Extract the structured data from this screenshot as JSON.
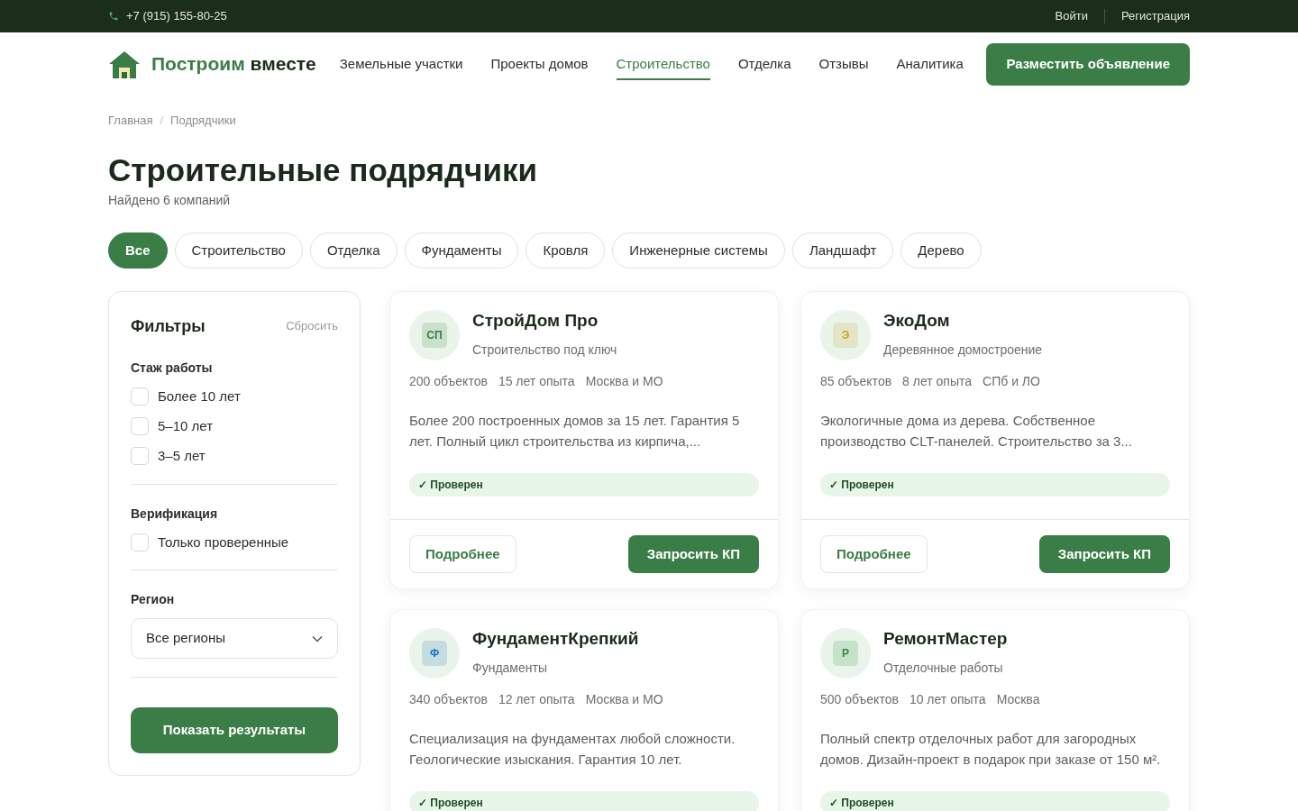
{
  "top_bar": {
    "phone": "+7 (915) 155-80-25",
    "links": [
      "Войти",
      "Регистрация"
    ]
  },
  "header": {
    "logo": {
      "accent": "Построим",
      "rest": "вместе"
    },
    "nav": [
      {
        "label": "Земельные участки",
        "selected": false
      },
      {
        "label": "Проекты домов",
        "selected": false
      },
      {
        "label": "Строительство",
        "selected": true
      },
      {
        "label": "Отделка",
        "selected": false
      },
      {
        "label": "Отзывы",
        "selected": false
      },
      {
        "label": "Аналитика",
        "selected": false
      }
    ],
    "cta": "Разместить объявление"
  },
  "breadcrumbs": {
    "items": [
      "Главная",
      "Подрядчики"
    ],
    "separator": "/"
  },
  "page": {
    "title": "Строительные подрядчики",
    "subtitle": "Найдено 6 компаний"
  },
  "categories": [
    {
      "label": "Все",
      "selected": true
    },
    {
      "label": "Строительство",
      "selected": false
    },
    {
      "label": "Отделка",
      "selected": false
    },
    {
      "label": "Фундаменты",
      "selected": false
    },
    {
      "label": "Кровля",
      "selected": false
    },
    {
      "label": "Инженерные системы",
      "selected": false
    },
    {
      "label": "Ландшафт",
      "selected": false
    },
    {
      "label": "Дерево",
      "selected": false
    }
  ],
  "filters": {
    "title": "Фильтры",
    "reset": "Сбросить",
    "groups": [
      {
        "kind": "checkboxes",
        "title": "Стаж работы",
        "options": [
          {
            "label": "Более 10 лет",
            "checked": false
          },
          {
            "label": "5–10 лет",
            "checked": false
          },
          {
            "label": "3–5 лет",
            "checked": false
          }
        ]
      },
      {
        "kind": "checkboxes",
        "title": "Верификация",
        "options": [
          {
            "label": "Только проверенные",
            "checked": false
          }
        ]
      },
      {
        "kind": "select",
        "title": "Регион",
        "value": "Все регионы"
      }
    ],
    "submit": "Показать результаты"
  },
  "companies": [
    {
      "initials": "СП",
      "color": "#3b7d46",
      "name": "СтройДом Про",
      "specialty": "Строительство под ключ",
      "stats": [
        "200 объектов",
        "15 лет опыта",
        "Москва и МО"
      ],
      "description": "Более 200 построенных домов за 15 лет. Гарантия 5 лет. Полный цикл строительства из кирпича,...",
      "badge": "✓ Проверен",
      "actions": {
        "details": "Подробнее",
        "request": "Запросить КП"
      }
    },
    {
      "initials": "Э",
      "color": "#c9a227",
      "name": "ЭкоДом",
      "specialty": "Деревянное домостроение",
      "stats": [
        "85 объектов",
        "8 лет опыта",
        "СПб и ЛО"
      ],
      "description": "Экологичные дома из дерева. Собственное производство CLT-панелей. Строительство за 3...",
      "badge": "✓ Проверен",
      "actions": {
        "details": "Подробнее",
        "request": "Запросить КП"
      }
    },
    {
      "initials": "Ф",
      "color": "#1f6fbf",
      "name": "ФундаментКрепкий",
      "specialty": "Фундаменты",
      "stats": [
        "340 объектов",
        "12 лет опыта",
        "Москва и МО"
      ],
      "description": "Специализация на фундаментах любой сложности. Геологические изыскания. Гарантия 10 лет.",
      "badge": "✓ Проверен"
    },
    {
      "initials": "Р",
      "color": "#2e8b3e",
      "name": "РемонтМастер",
      "specialty": "Отделочные работы",
      "stats": [
        "500 объектов",
        "10 лет опыта",
        "Москва"
      ],
      "description": "Полный спектр отделочных работ для загородных домов. Дизайн-проект в подарок при заказе от 150 м².",
      "badge": "✓ Проверен"
    }
  ]
}
